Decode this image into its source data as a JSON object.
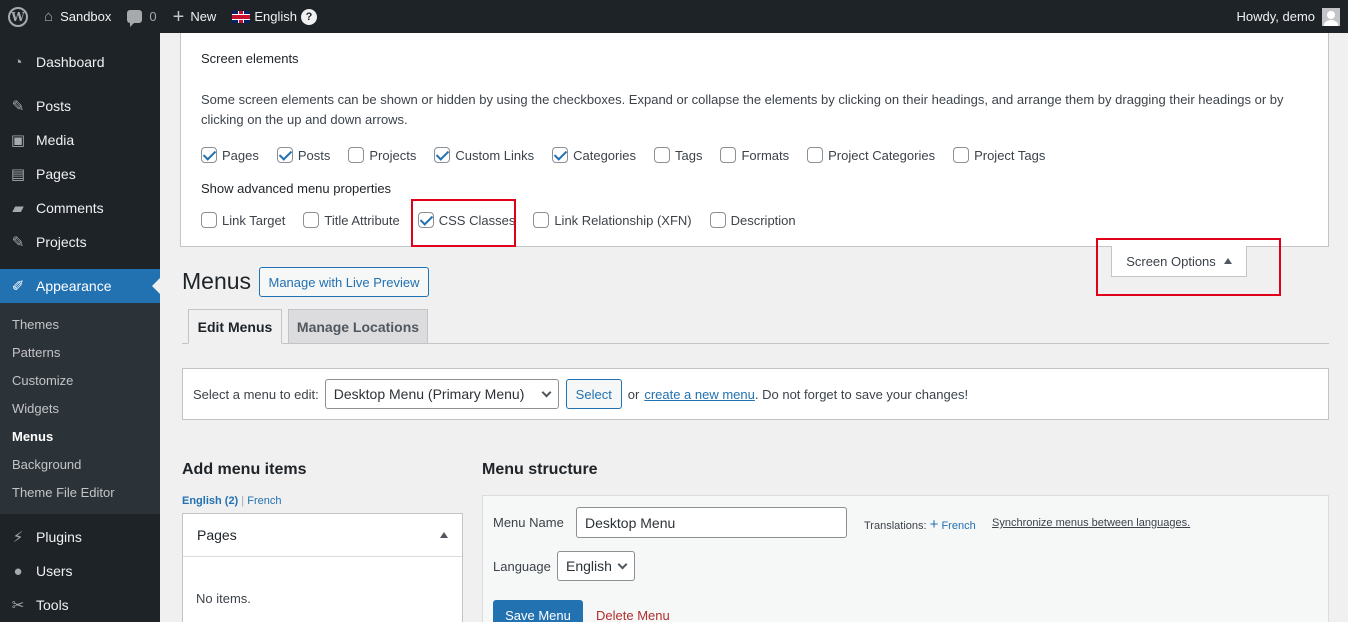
{
  "adminbar": {
    "site": "Sandbox",
    "comments_count": "0",
    "new_label": "New",
    "language": "English",
    "howdy": "Howdy, demo"
  },
  "sidebar": {
    "items": [
      {
        "label": "Dashboard",
        "icon": "dashboard-icon"
      },
      {
        "label": "Posts",
        "icon": "pin-icon"
      },
      {
        "label": "Media",
        "icon": "media-icon"
      },
      {
        "label": "Pages",
        "icon": "page-icon"
      },
      {
        "label": "Comments",
        "icon": "comment-icon"
      },
      {
        "label": "Projects",
        "icon": "pin-icon"
      },
      {
        "label": "Appearance",
        "icon": "brush-icon"
      }
    ],
    "appearance_sub": [
      "Themes",
      "Patterns",
      "Customize",
      "Widgets",
      "Menus",
      "Background",
      "Theme File Editor"
    ],
    "items_after": [
      {
        "label": "Plugins",
        "icon": "plug-icon"
      },
      {
        "label": "Users",
        "icon": "user-icon"
      },
      {
        "label": "Tools",
        "icon": "wrench-icon"
      }
    ]
  },
  "screen_options": {
    "heading": "Screen elements",
    "description": "Some screen elements can be shown or hidden by using the checkboxes. Expand or collapse the elements by clicking on their headings, and arrange them by dragging their headings or by clicking on the up and down arrows.",
    "elements": [
      {
        "label": "Pages",
        "checked": true
      },
      {
        "label": "Posts",
        "checked": true
      },
      {
        "label": "Projects",
        "checked": false
      },
      {
        "label": "Custom Links",
        "checked": true
      },
      {
        "label": "Categories",
        "checked": true
      },
      {
        "label": "Tags",
        "checked": false
      },
      {
        "label": "Formats",
        "checked": false
      },
      {
        "label": "Project Categories",
        "checked": false
      },
      {
        "label": "Project Tags",
        "checked": false
      }
    ],
    "advanced_heading": "Show advanced menu properties",
    "advanced": [
      {
        "label": "Link Target",
        "checked": false
      },
      {
        "label": "Title Attribute",
        "checked": false
      },
      {
        "label": "CSS Classes",
        "checked": true
      },
      {
        "label": "Link Relationship (XFN)",
        "checked": false
      },
      {
        "label": "Description",
        "checked": false
      }
    ],
    "tab_label": "Screen Options"
  },
  "menus": {
    "title": "Menus",
    "live_preview": "Manage with Live Preview",
    "tabs": [
      "Edit Menus",
      "Manage Locations"
    ],
    "select_label": "Select a menu to edit:",
    "selected_menu": "Desktop Menu (Primary Menu)",
    "select_button": "Select",
    "or_text": "or",
    "create_link": "create a new menu",
    "save_reminder": ". Do not forget to save your changes!"
  },
  "add_items": {
    "heading": "Add menu items",
    "lang_current": "English (2)",
    "lang_sep": "|",
    "lang_other": "French",
    "panel_title": "Pages",
    "panel_empty": "No items."
  },
  "structure": {
    "heading": "Menu structure",
    "name_label": "Menu Name",
    "name_value": "Desktop Menu",
    "translations_label": "Translations:",
    "translation_fr": "French",
    "sync_link": "Synchronize menus between languages.",
    "language_label": "Language",
    "language_value": "English",
    "save_button": "Save Menu",
    "delete_link": "Delete Menu"
  }
}
